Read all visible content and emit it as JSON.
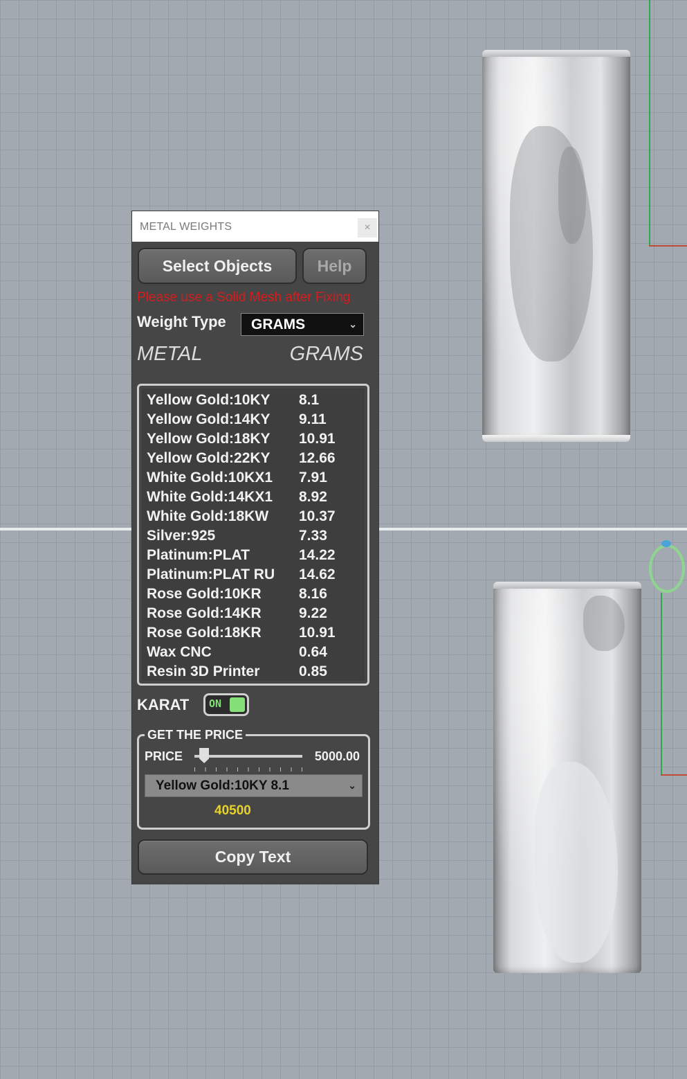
{
  "dialog": {
    "title": "METAL WEIGHTS",
    "close_symbol": "×",
    "select_button": "Select Objects",
    "help_button": "Help",
    "warning": "Please use a Solid Mesh after Fixing",
    "weight_type_label": "Weight Type",
    "weight_type_value": "GRAMS",
    "col_metal": "METAL",
    "col_grams": "GRAMS",
    "metals": [
      {
        "name": "Yellow Gold:10KY",
        "grams": "8.1"
      },
      {
        "name": "Yellow Gold:14KY",
        "grams": "9.11"
      },
      {
        "name": "Yellow Gold:18KY",
        "grams": "10.91"
      },
      {
        "name": "Yellow Gold:22KY",
        "grams": "12.66"
      },
      {
        "name": "White Gold:10KX1",
        "grams": "7.91"
      },
      {
        "name": "White Gold:14KX1",
        "grams": "8.92"
      },
      {
        "name": "White Gold:18KW",
        "grams": "10.37"
      },
      {
        "name": "Silver:925",
        "grams": "7.33"
      },
      {
        "name": "Platinum:PLAT",
        "grams": "14.22"
      },
      {
        "name": "Platinum:PLAT RU",
        "grams": "14.62"
      },
      {
        "name": "Rose Gold:10KR",
        "grams": "8.16"
      },
      {
        "name": "Rose Gold:14KR",
        "grams": "9.22"
      },
      {
        "name": "Rose Gold:18KR",
        "grams": "10.91"
      },
      {
        "name": "Wax  CNC",
        "grams": "0.64"
      },
      {
        "name": "Resin 3D Printer",
        "grams": "0.85"
      }
    ],
    "karat_label": "KARAT",
    "karat_toggle": "ON",
    "price_group_title": "GET THE PRICE",
    "price_label": "PRICE",
    "price_value": "5000.00",
    "price_slider_level": 0.05,
    "selected_metal": "Yellow Gold:10KY 8.1",
    "price_total": "40500",
    "copy_button": "Copy Text",
    "select_chevron": "⌄"
  },
  "colors": {
    "panel_bg": "#464646",
    "warning": "#d81b1b",
    "toggle_on": "#86e07a",
    "total": "#e6d22a",
    "viewport_bg": "#a3a9b1"
  }
}
